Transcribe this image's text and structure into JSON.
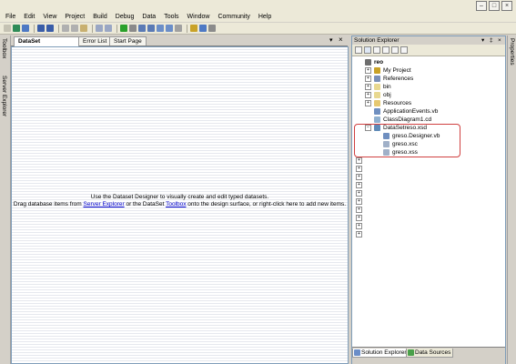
{
  "menu": [
    "File",
    "Edit",
    "View",
    "Project",
    "Build",
    "Debug",
    "Data",
    "Tools",
    "Window",
    "Community",
    "Help"
  ],
  "left_strip": {
    "toolbox": "Toolbox",
    "server_explorer": "Server Explorer"
  },
  "document_tabs": {
    "active": "DataSet",
    "others": [
      "Error List",
      "Start Page"
    ]
  },
  "designer": {
    "line1": "Use the Dataset Designer to visually create and edit typed datasets.",
    "line2_prefix": "Drag database items from ",
    "link_server_explorer": "Server Explorer",
    "line2_mid": " or the DataSet ",
    "link_toolbox": "Toolbox",
    "line2_suffix": " onto the design surface, or right-click here to add new items."
  },
  "solution_explorer": {
    "title": "Solution Explorer",
    "pin_glyph": "− \u0000 ×",
    "tree": [
      {
        "label": "reo",
        "indent": 0,
        "expander": "",
        "bold": true,
        "color": "#6d6d6d"
      },
      {
        "label": "My Project",
        "indent": 1,
        "expander": "+",
        "color": "#c9a227"
      },
      {
        "label": "References",
        "indent": 1,
        "expander": "+",
        "color": "#7a90b8"
      },
      {
        "label": "bin",
        "indent": 1,
        "expander": "+",
        "color": "#e8d890"
      },
      {
        "label": "obj",
        "indent": 1,
        "expander": "+",
        "color": "#e8d890"
      },
      {
        "label": "Resources",
        "indent": 1,
        "expander": "+",
        "color": "#e6c870"
      },
      {
        "label": "ApplicationEvents.vb",
        "indent": 1,
        "expander": "",
        "color": "#6f8fc0"
      },
      {
        "label": "ClassDiagram1.cd",
        "indent": 1,
        "expander": "",
        "color": "#8fb0d0"
      },
      {
        "label": "DataSetreso.xsd",
        "indent": 1,
        "expander": "−",
        "color": "#5f8ab8"
      },
      {
        "label": "greso.Designer.vb",
        "indent": 2,
        "expander": "",
        "color": "#6f8fc0"
      },
      {
        "label": "greso.xsc",
        "indent": 2,
        "expander": "",
        "color": "#a0b0c8"
      },
      {
        "label": "greso.xss",
        "indent": 2,
        "expander": "",
        "color": "#a0b0c8"
      }
    ],
    "collapsed_rows": 10,
    "bottom_tabs": [
      "Solution Explorer",
      "Data Sources"
    ]
  },
  "properties_strip": "Properties",
  "colors": {
    "highlight": "#d04040",
    "link": "#0000cc",
    "panel_border": "#7f9db9"
  }
}
